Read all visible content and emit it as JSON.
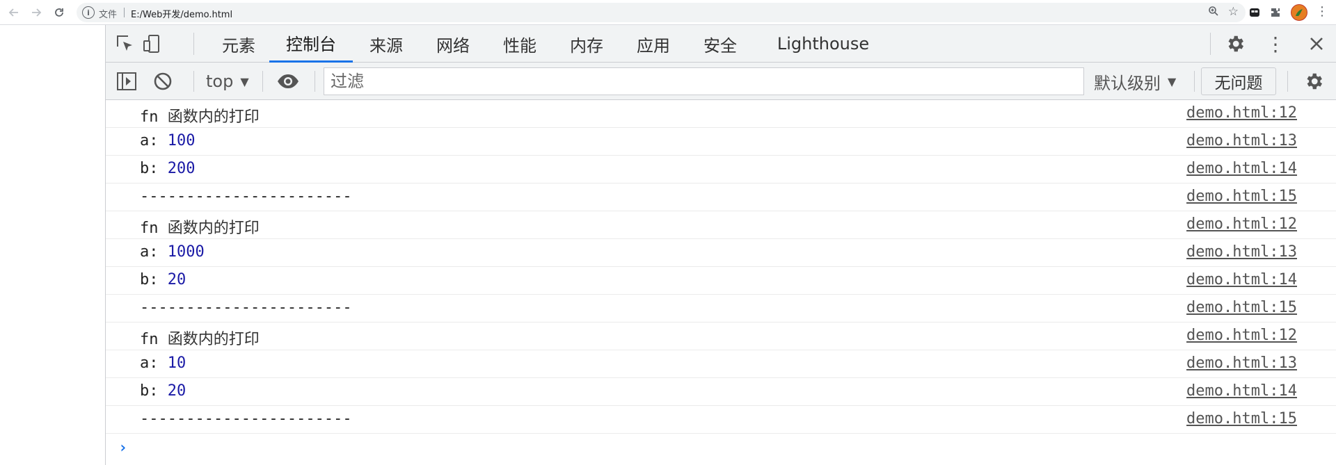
{
  "browser": {
    "omnibox_label": "文件",
    "url": "E:/Web开发/demo.html"
  },
  "devtools": {
    "tabs": [
      {
        "label": "元素"
      },
      {
        "label": "控制台"
      },
      {
        "label": "来源"
      },
      {
        "label": "网络"
      },
      {
        "label": "性能"
      },
      {
        "label": "内存"
      },
      {
        "label": "应用"
      },
      {
        "label": "安全"
      },
      {
        "label": "Lighthouse"
      }
    ],
    "active_tab": "控制台",
    "toolbar": {
      "context": "top",
      "filter_placeholder": "过滤",
      "levels": "默认级别",
      "issues": "无问题"
    }
  },
  "console": {
    "messages": [
      {
        "label": "fn",
        "text": "函数内的打印",
        "source": "demo.html:12"
      },
      {
        "label": "a:",
        "value": "100",
        "source": "demo.html:13"
      },
      {
        "label": "b:",
        "value": "200",
        "source": "demo.html:14"
      },
      {
        "label": "-----------------------",
        "source": "demo.html:15"
      },
      {
        "label": "fn",
        "text": "函数内的打印",
        "source": "demo.html:12"
      },
      {
        "label": "a:",
        "value": "1000",
        "source": "demo.html:13"
      },
      {
        "label": "b:",
        "value": "20",
        "source": "demo.html:14"
      },
      {
        "label": "-----------------------",
        "source": "demo.html:15"
      },
      {
        "label": "fn",
        "text": "函数内的打印",
        "source": "demo.html:12"
      },
      {
        "label": "a:",
        "value": "10",
        "source": "demo.html:13"
      },
      {
        "label": "b:",
        "value": "20",
        "source": "demo.html:14"
      },
      {
        "label": "-----------------------",
        "source": "demo.html:15"
      }
    ]
  },
  "colors": {
    "accent": "#1a73e8",
    "number": "#1a1aa6",
    "toolbar_bg": "#f1f3f4"
  }
}
